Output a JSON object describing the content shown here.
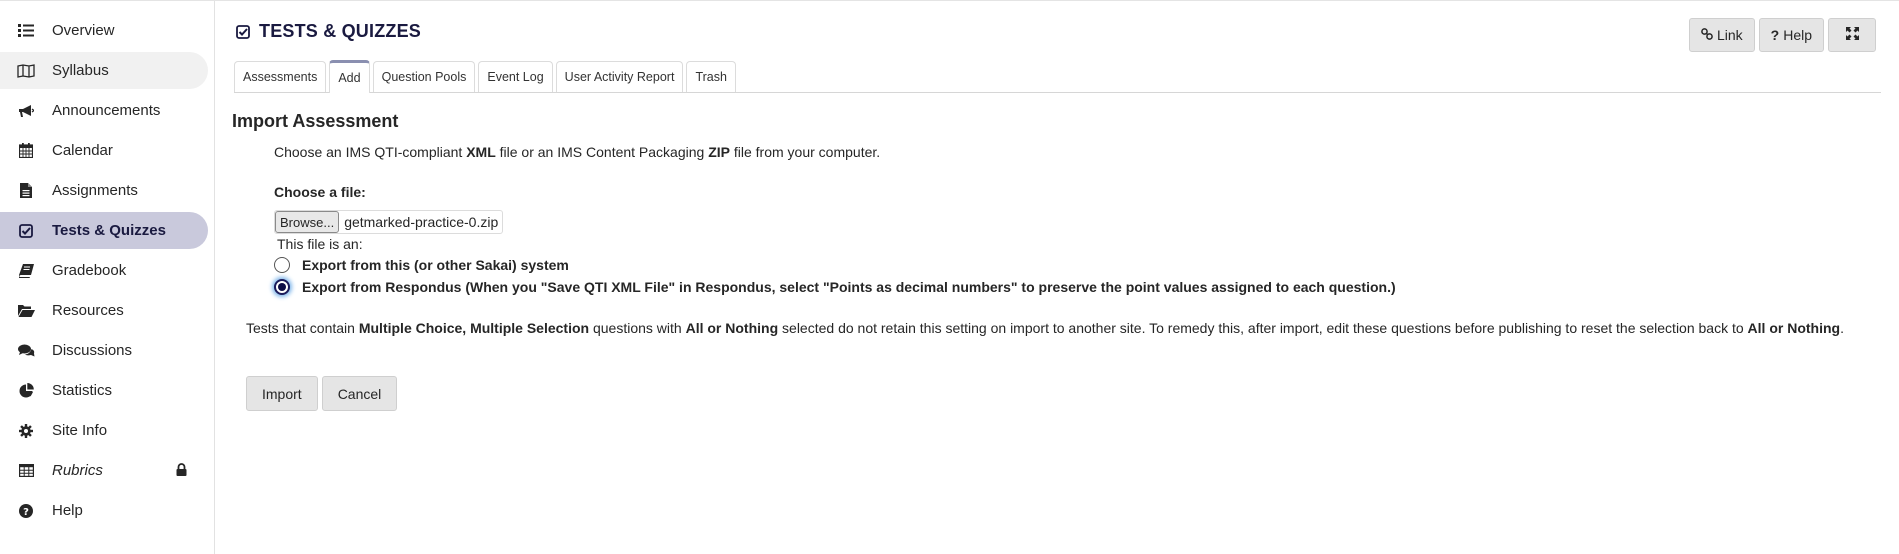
{
  "sidebar": {
    "items": [
      {
        "label": "Overview",
        "icon": "list-icon"
      },
      {
        "label": "Syllabus",
        "icon": "map-icon",
        "state": "hover"
      },
      {
        "label": "Announcements",
        "icon": "bullhorn-icon"
      },
      {
        "label": "Calendar",
        "icon": "calendar-icon"
      },
      {
        "label": "Assignments",
        "icon": "file-text-icon"
      },
      {
        "label": "Tests & Quizzes",
        "icon": "check-square-icon",
        "state": "active"
      },
      {
        "label": "Gradebook",
        "icon": "book-icon"
      },
      {
        "label": "Resources",
        "icon": "folder-open-icon"
      },
      {
        "label": "Discussions",
        "icon": "comments-icon"
      },
      {
        "label": "Statistics",
        "icon": "pie-chart-icon"
      },
      {
        "label": "Site Info",
        "icon": "gear-icon"
      },
      {
        "label": "Rubrics",
        "icon": "table-icon",
        "locked": true
      },
      {
        "label": "Help",
        "icon": "question-circle-icon"
      }
    ]
  },
  "header": {
    "title": "TESTS & QUIZZES",
    "link_label": "Link",
    "help_label": "Help",
    "help_glyph": "?",
    "expand_icon": "expand-icon"
  },
  "tabs": [
    {
      "label": "Assessments",
      "active": false
    },
    {
      "label": "Add",
      "active": true
    },
    {
      "label": "Question Pools",
      "active": false
    },
    {
      "label": "Event Log",
      "active": false
    },
    {
      "label": "User Activity Report",
      "active": false
    },
    {
      "label": "Trash",
      "active": false
    }
  ],
  "import": {
    "title": "Import Assessment",
    "instructions": {
      "part1": "Choose an IMS QTI-compliant ",
      "bold1": "XML",
      "part2": " file or an IMS Content Packaging ",
      "bold2": "ZIP",
      "part3": " file from your computer."
    },
    "choose_label": "Choose a file:",
    "browse_label": "Browse...",
    "file_name": "getmarked-practice-0.zip",
    "file_type_label": "This file is an:",
    "options": [
      {
        "label": "Export from this (or other Sakai) system",
        "checked": false
      },
      {
        "label": "Export from Respondus (When you \"Save QTI XML File\" in Respondus, select \"Points as decimal numbers\" to preserve the point values assigned to each question.)",
        "checked": true
      }
    ],
    "warning": {
      "t1": "Tests that contain ",
      "b1": "Multiple Choice, Multiple Selection",
      "t2": " questions with ",
      "b2": "All or Nothing",
      "t3": " selected do not retain this setting on import to another site. To remedy this, after import, edit these questions before publishing to reset the selection back to ",
      "b3": "All or Nothing",
      "t4": "."
    },
    "import_label": "Import",
    "cancel_label": "Cancel"
  },
  "colors": {
    "active_nav_bg": "#c9c9dc",
    "title_color": "#1a1a40",
    "radio_checked": "#0d0d45"
  }
}
